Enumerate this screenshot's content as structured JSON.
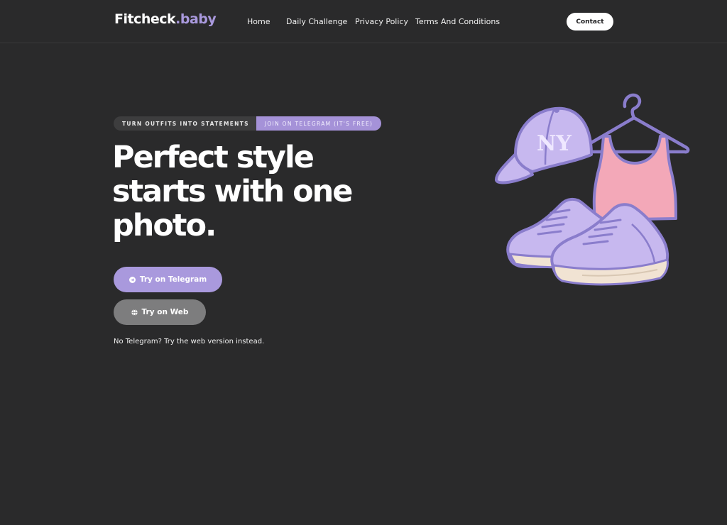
{
  "header": {
    "logo_main": "Fitcheck",
    "logo_accent": ".baby",
    "nav": [
      "Home",
      "Daily Challenge",
      "Privacy Policy",
      "Terms And Conditions"
    ],
    "contact_label": "Contact"
  },
  "hero": {
    "tag_left": "TURN OUTFITS INTO STATEMENTS",
    "tag_right": "JOIN ON TELEGRAM (IT'S FREE)",
    "headline": [
      "Perfect style",
      "starts with one",
      "photo."
    ],
    "telegram_button": "Try on Telegram",
    "web_button": "Try on Web",
    "note": "No Telegram? Try the web version instead."
  },
  "illustration": {
    "cap_text": "NY",
    "icons": [
      "cap-icon",
      "hanger-icon",
      "tank-top-icon",
      "sneaker-icon"
    ]
  },
  "colors": {
    "background": "#2a2a2b",
    "accent": "#a999dd",
    "web_button": "#7d7d7e",
    "tank_top": "#f3a8b8",
    "sneaker_sole": "#f1e3d3"
  }
}
